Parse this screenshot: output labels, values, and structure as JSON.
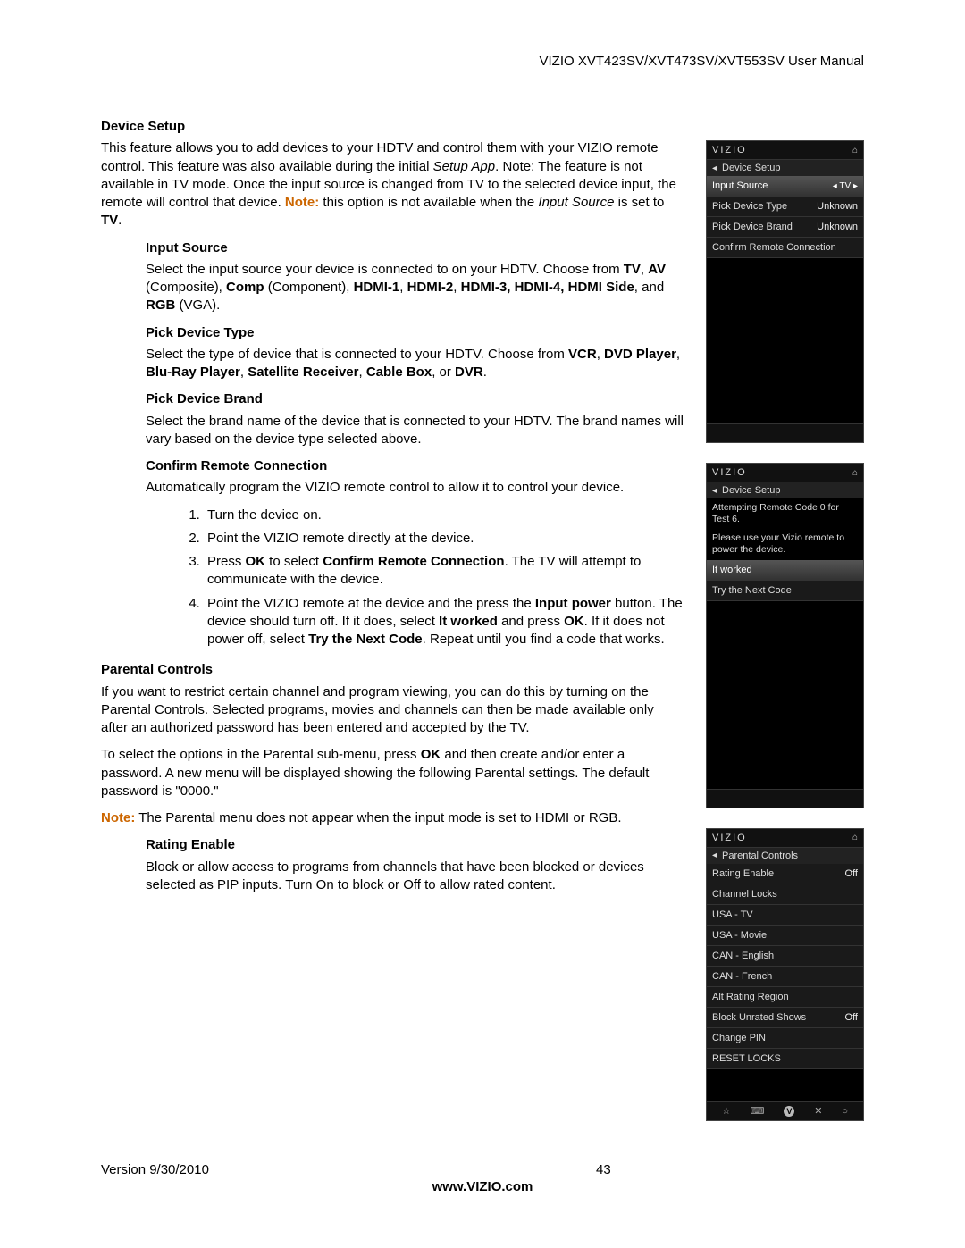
{
  "header": "VIZIO XVT423SV/XVT473SV/XVT553SV User Manual",
  "sections": {
    "deviceSetup": {
      "heading": "Device Setup",
      "para1a": "This feature allows you to add devices to your HDTV and control them with your VIZIO remote control. This feature was also available during the initial ",
      "para1b": "Setup App",
      "para1c": ". Note: The feature is not available in TV mode. Once the input source is changed from TV to the selected device input, the remote will control that device. ",
      "noteLabel": "Note:",
      "para1d": "  this option is not available when the ",
      "para1e": "Input Source",
      "para1f": " is set to ",
      "para1g": "TV",
      "para1h": "."
    },
    "inputSource": {
      "heading": "Input Source",
      "p1": "Select the input source your device is connected to on your HDTV. Choose from ",
      "b1": "TV",
      "c1": ", ",
      "b2": "AV",
      "c2": " (Composite), ",
      "b3": "Comp",
      "c3": " (Component), ",
      "b4": "HDMI-1",
      "c4": ", ",
      "b5": "HDMI-2",
      "c5": ", ",
      "b6": "HDMI-3, HDMI-4,  HDMI Side",
      "c6": ", and ",
      "b7": "RGB",
      "c7": " (VGA)."
    },
    "pickType": {
      "heading": "Pick Device Type",
      "p1": "Select the type of device that is connected to your HDTV. Choose from ",
      "b1": "VCR",
      "c1": ", ",
      "b2": "DVD Player",
      "c2": ", ",
      "b3": "Blu-Ray Player",
      "c3": ", ",
      "b4": "Satellite Receiver",
      "c4": ", ",
      "b5": "Cable Box",
      "c5": ", or ",
      "b6": "DVR",
      "c6": "."
    },
    "pickBrand": {
      "heading": "Pick Device Brand",
      "p": "Select the brand name of the device that is connected to your HDTV. The brand names will vary based on the device type selected above."
    },
    "confirm": {
      "heading": "Confirm Remote Connection",
      "p": "Automatically program the VIZIO remote control to allow it to control your device.",
      "s1": "Turn the device on.",
      "s2": "Point the VIZIO remote directly at the device.",
      "s3a": "Press ",
      "s3b": "OK",
      "s3c": " to select ",
      "s3d": "Confirm Remote Connection",
      "s3e": ". The TV will attempt to communicate with the device.",
      "s4a": "Point the VIZIO remote at the device and the press the ",
      "s4b": "Input power",
      "s4c": " button. The device should turn off. If it does, select ",
      "s4d": "It worked",
      "s4e": " and press ",
      "s4f": "OK",
      "s4g": ". If it does not power off, select ",
      "s4h": "Try the Next Code",
      "s4i": ". Repeat until you find a code that works."
    },
    "parental": {
      "heading": "Parental Controls",
      "p1": " If you want to restrict certain channel and program viewing, you can do this by turning on the Parental Controls. Selected programs, movies and channels can then be made available only after an authorized password has been entered and accepted by the TV.",
      "p2a": "To select the options in the Parental sub-menu, press ",
      "p2b": "OK",
      "p2c": " and then create and/or enter a password. A new menu will be displayed showing the following Parental settings. The default password is \"0000.\"",
      "p3b": " The Parental menu does not appear when the input mode is set to HDMI or RGB."
    },
    "rating": {
      "heading": "Rating Enable",
      "p": "Block or allow access to programs from channels that have been blocked or devices selected as PIP inputs. Turn On to block or Off to allow rated content."
    }
  },
  "menus": {
    "logo": "VIZIO",
    "m1": {
      "title": "Device Setup",
      "r1": {
        "label": "Input Source",
        "val": "◂ TV ▸"
      },
      "r2": {
        "label": "Pick Device Type",
        "val": "Unknown"
      },
      "r3": {
        "label": "Pick Device Brand",
        "val": "Unknown"
      },
      "r4": {
        "label": "Confirm Remote Connection"
      }
    },
    "m2": {
      "title": "Device Setup",
      "msg1": "Attempting Remote Code 0 for Test 6.",
      "msg2": "Please use your Vizio remote to power the device.",
      "r1": "It worked",
      "r2": "Try the Next Code"
    },
    "m3": {
      "title": "Parental Controls",
      "r1": {
        "label": "Rating Enable",
        "val": "Off"
      },
      "r2": "Channel Locks",
      "r3": "USA - TV",
      "r4": "USA - Movie",
      "r5": "CAN - English",
      "r6": "CAN - French",
      "r7": "Alt Rating Region",
      "r8": {
        "label": "Block Unrated Shows",
        "val": "Off"
      },
      "r9": "Change PIN",
      "r10": "RESET LOCKS"
    }
  },
  "footer": {
    "version": "Version 9/30/2010",
    "page": "43",
    "url": "www.VIZIO.com"
  }
}
